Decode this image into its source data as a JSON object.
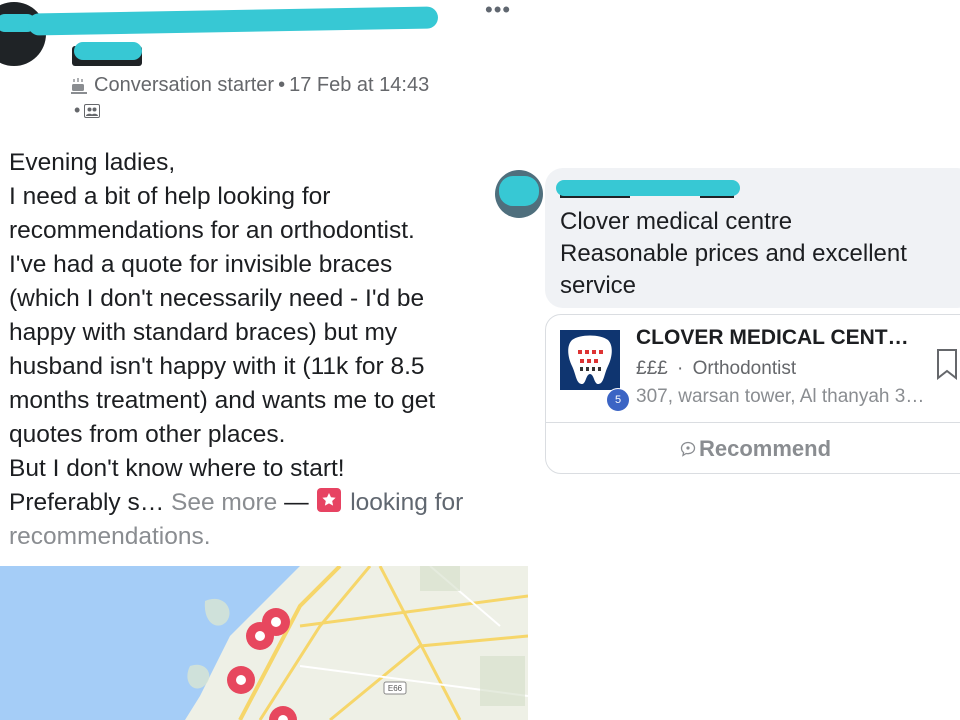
{
  "post": {
    "meta": {
      "badge_label": "Conversation starter",
      "separator": "•",
      "date": "17 Feb at 14:43"
    },
    "lines": [
      "Evening ladies,",
      "I need a bit of help looking for",
      "recommendations for an orthodontist.",
      "I've had a quote for invisible braces",
      "(which I don't necessarily need - I'd be",
      "happy with standard braces) but my",
      "husband isn't happy with it (11k for 8.5",
      "months treatment) and wants me to get",
      "quotes from other places.",
      "But I don't know where to start!"
    ],
    "last_line": {
      "start": "Preferably s…",
      "see_more": "See more",
      "dash": "—",
      "tag": "looking for",
      "end": "recommendations."
    }
  },
  "map": {
    "road_label": "E66",
    "colors": {
      "sea": "#a5cdf7",
      "land": "#eef0e6",
      "road": "#f6d66a",
      "pin": "#e7475e"
    }
  },
  "comment": {
    "text_line1": "Clover medical centre",
    "text_line2": "Reasonable prices and excellent service"
  },
  "place_card": {
    "title": "CLOVER MEDICAL CENT…",
    "price": "£££",
    "separator": "·",
    "category": "Orthodontist",
    "address": "307, warsan tower, Al thanyah 3…",
    "badge_count": "5",
    "recommend_label": "Recommend"
  },
  "icons": [
    "more-icon",
    "coffee-icon",
    "group-icon",
    "tag-star-icon",
    "bookmark-icon",
    "comment-icon"
  ]
}
